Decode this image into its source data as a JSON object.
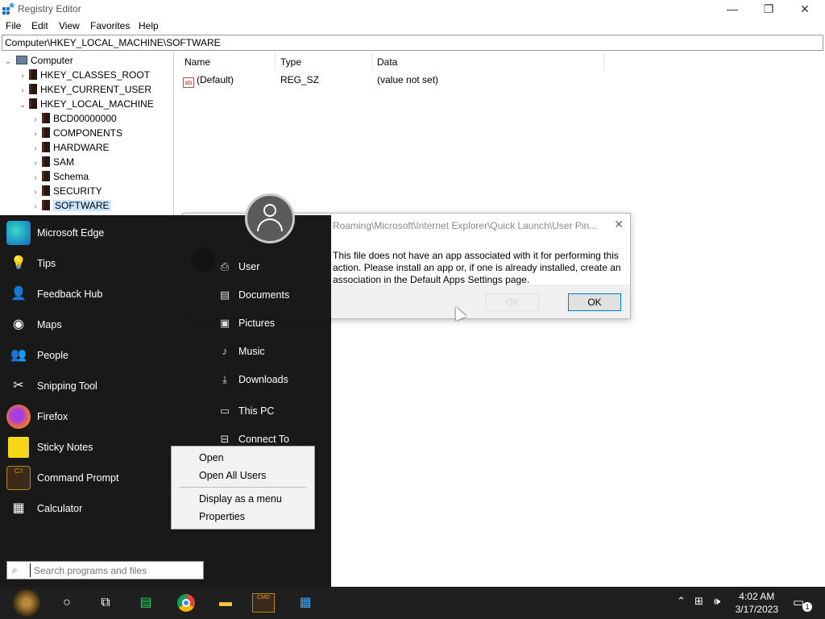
{
  "window": {
    "title": "Registry Editor",
    "menu": [
      "File",
      "Edit",
      "View",
      "Favorites",
      "Help"
    ],
    "address": "Computer\\HKEY_LOCAL_MACHINE\\SOFTWARE",
    "controls": {
      "minimize": "—",
      "maximize": "❐",
      "close": "✕"
    }
  },
  "tree": [
    {
      "label": "Computer",
      "level": 0,
      "expanded": true
    },
    {
      "label": "HKEY_CLASSES_ROOT",
      "level": 1
    },
    {
      "label": "HKEY_CURRENT_USER",
      "level": 1
    },
    {
      "label": "HKEY_LOCAL_MACHINE",
      "level": 1,
      "expanded": true
    },
    {
      "label": "BCD00000000",
      "level": 2
    },
    {
      "label": "COMPONENTS",
      "level": 2
    },
    {
      "label": "HARDWARE",
      "level": 2
    },
    {
      "label": "SAM",
      "level": 2
    },
    {
      "label": "Schema",
      "level": 2
    },
    {
      "label": "SECURITY",
      "level": 2
    },
    {
      "label": "SOFTWARE",
      "level": 2,
      "selected": true
    }
  ],
  "values_pane": {
    "columns": [
      "Name",
      "Type",
      "Data"
    ],
    "rows": [
      {
        "name": "(Default)",
        "type": "REG_SZ",
        "data": "(value not set)"
      }
    ]
  },
  "dialog": {
    "title_fragment": "Roaming\\Microsoft\\Internet Explorer\\Quick Launch\\User Pin...",
    "message": "This file does not have an app associated with it for performing this action. Please install an app or, if one is already installed, create an association in the Default Apps Settings page.",
    "ok_label": "OK",
    "ghost_label": "OK"
  },
  "start_menu": {
    "programs": [
      "Microsoft Edge",
      "Tips",
      "Feedback Hub",
      "Maps",
      "People",
      "Snipping Tool",
      "Firefox",
      "Sticky Notes",
      "Command Prompt",
      "Calculator"
    ],
    "links": [
      "User",
      "Documents",
      "Pictures",
      "Music",
      "Downloads",
      "This PC",
      "Connect To"
    ],
    "search_placeholder": "Search programs and files"
  },
  "context_menu": {
    "items": [
      "Open",
      "Open All Users",
      "Display as a menu",
      "Properties"
    ]
  },
  "taskbar": {
    "time": "4:02 AM",
    "date": "3/17/2023",
    "notification_count": "1"
  },
  "colors": {
    "selection": "#cce8ff",
    "accent": "#0078d7",
    "start_menu_bg": "#121212",
    "taskbar_bg": "#1f1f1f"
  }
}
